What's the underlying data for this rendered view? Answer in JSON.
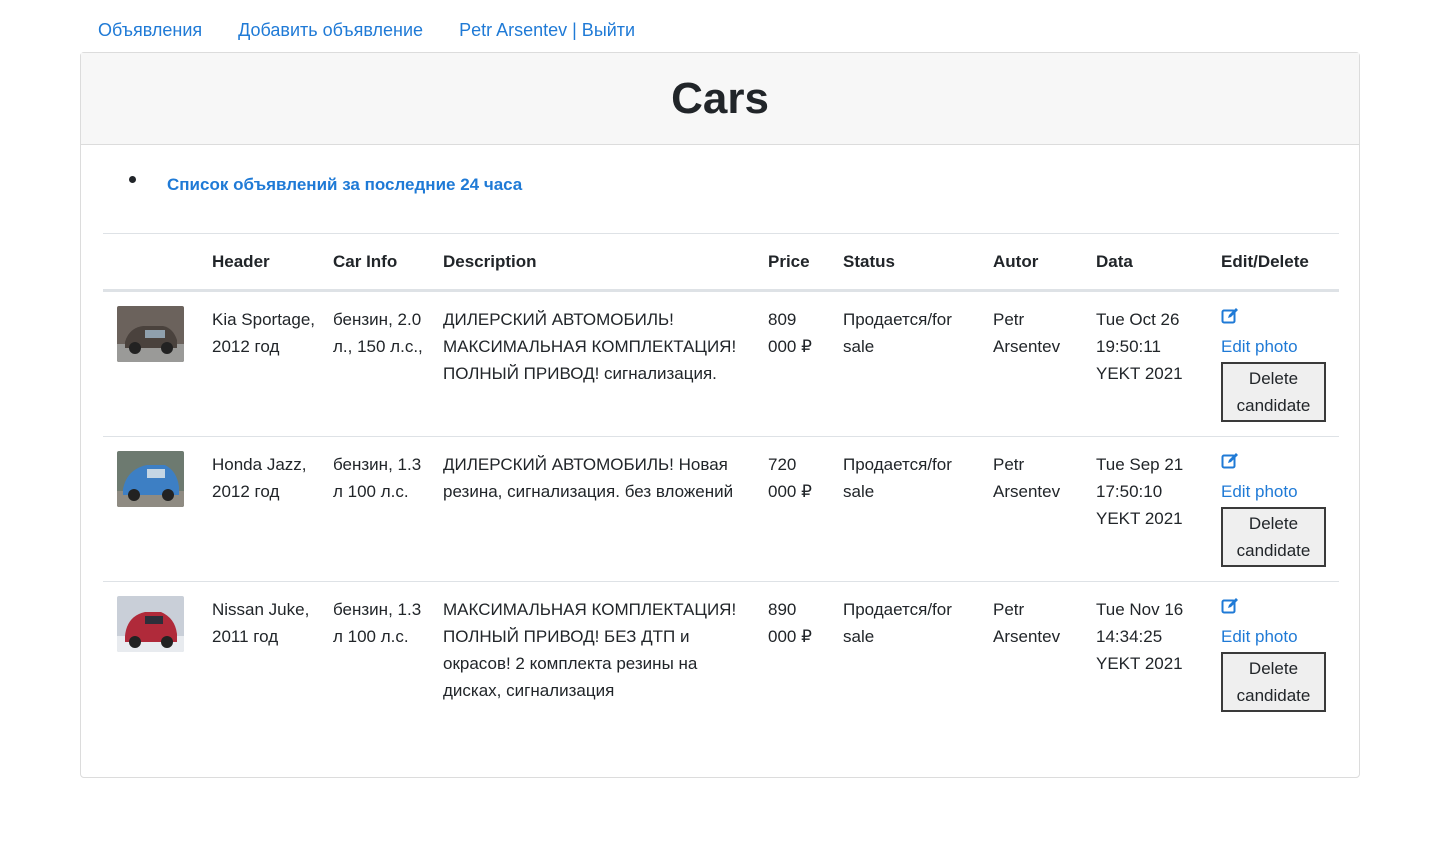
{
  "nav": {
    "ads": "Объявления",
    "add": "Добавить объявление",
    "user": "Petr Arsentev | Выйти"
  },
  "card": {
    "title": "Cars",
    "link_24h": "Список объявлений за последние 24 часа"
  },
  "table": {
    "headers": [
      "",
      "Header",
      "Car Info",
      "Description",
      "Price",
      "Status",
      "Autor",
      "Data",
      "Edit/Delete"
    ],
    "edit_label": "Edit photo",
    "delete_label": "Delete candidate",
    "rows": [
      {
        "header": "Kia Sportage, 2012 год",
        "car_info": "бензин, 2.0 л., 150 л.с.,",
        "description": "ДИЛЕРСКИЙ АВТОМОБИЛЬ! МАКСИМАЛЬНАЯ КОМПЛЕКТАЦИЯ! ПОЛНЫЙ ПРИВОД! сигнализация.",
        "price": "809 000 ₽",
        "status": "Продается/for sale",
        "autor": "Petr Arsentev",
        "date": "Tue Oct 26 19:50:11 YEKT 2021",
        "thumb_color": "#6b625c"
      },
      {
        "header": "Honda Jazz, 2012 год",
        "car_info": "бензин, 1.3 л 100 л.с.",
        "description": "ДИЛЕРСКИЙ АВТОМОБИЛЬ! Новая резина, сигнализация. без вложений",
        "price": "720 000 ₽",
        "status": "Продается/for sale",
        "autor": "Petr Arsentev",
        "date": "Tue Sep 21 17:50:10 YEKT 2021",
        "thumb_color": "#3d7fc4"
      },
      {
        "header": "Nissan Juke, 2011 год",
        "car_info": "бензин, 1.3 л 100 л.с.",
        "description": "МАКСИМАЛЬНАЯ КОМПЛЕКТАЦИЯ! ПОЛНЫЙ ПРИВОД! БЕЗ ДТП и окрасов! 2 комплекта резины на дисках, сигнализация",
        "price": "890 000 ₽",
        "status": "Продается/for sale",
        "autor": "Petr Arsentev",
        "date": "Tue Nov 16 14:34:25 YEKT 2021",
        "thumb_color": "#b02a3a"
      }
    ]
  },
  "colors": {
    "link": "#1f7ad6",
    "header_bg": "#f7f7f7",
    "border": "#dee2e6"
  }
}
